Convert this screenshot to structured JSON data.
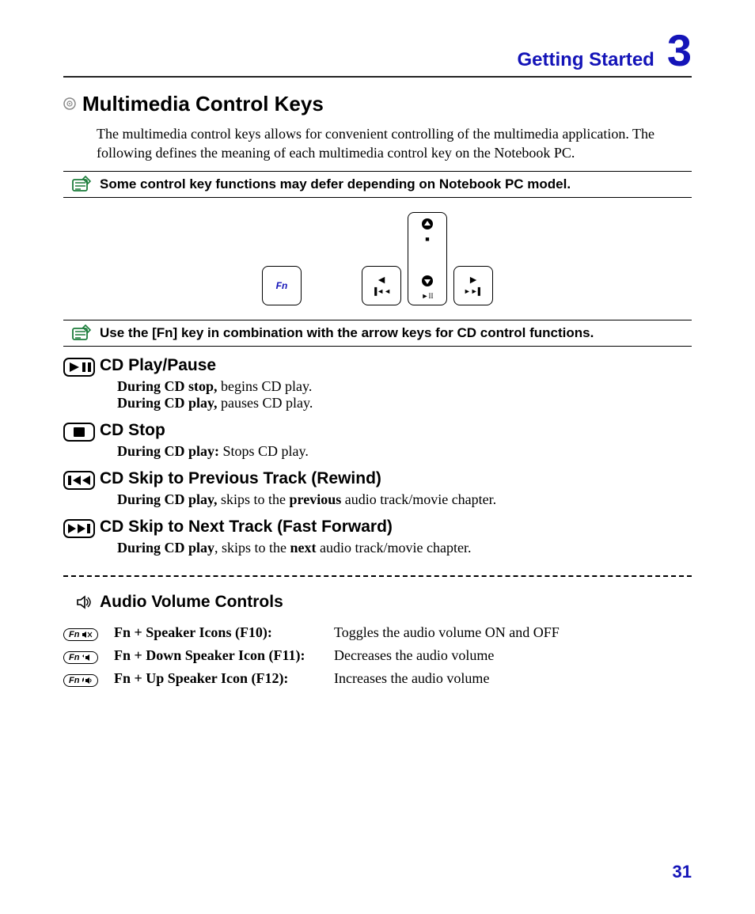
{
  "header": {
    "title": "Getting Started",
    "chapter": "3"
  },
  "main_section": {
    "title": "Multimedia Control Keys",
    "intro": "The multimedia control keys allows for convenient controlling of the multimedia application. The following defines the meaning of each multimedia control key on the Notebook PC."
  },
  "notes": {
    "model": "Some control key functions may defer depending on Notebook PC model.",
    "fn_combo": "Use the [Fn] key in combination with the arrow keys for CD control functions."
  },
  "keys": {
    "fn": "Fn"
  },
  "features": {
    "play_pause": {
      "title": "CD Play/Pause",
      "line1_bold": "During CD stop,",
      "line1_rest": " begins CD play.",
      "line2_bold": "During CD play,",
      "line2_rest": " pauses CD play."
    },
    "stop": {
      "title": "CD Stop",
      "line1_bold": "During CD play:",
      "line1_rest": " Stops CD play."
    },
    "prev": {
      "title": "CD Skip to Previous Track (Rewind)",
      "line1_bold": "During CD play,",
      "line1_mid": " skips to the ",
      "line1_bold2": "previous",
      "line1_rest": " audio track/movie chapter."
    },
    "next": {
      "title": "CD Skip to Next Track (Fast Forward)",
      "line1_bold": "During CD play",
      "line1_mid": ", skips to the ",
      "line1_bold2": "next",
      "line1_rest": " audio track/movie chapter."
    }
  },
  "audio": {
    "title": "Audio Volume Controls",
    "rows": [
      {
        "label": "Fn + Speaker Icons (F10):",
        "desc": "Toggles the audio volume ON and OFF"
      },
      {
        "label": "Fn + Down Speaker Icon (F11):",
        "desc": "Decreases the audio volume"
      },
      {
        "label": "Fn + Up Speaker Icon (F12):",
        "desc": "Increases the audio volume"
      }
    ]
  },
  "page_number": "31"
}
